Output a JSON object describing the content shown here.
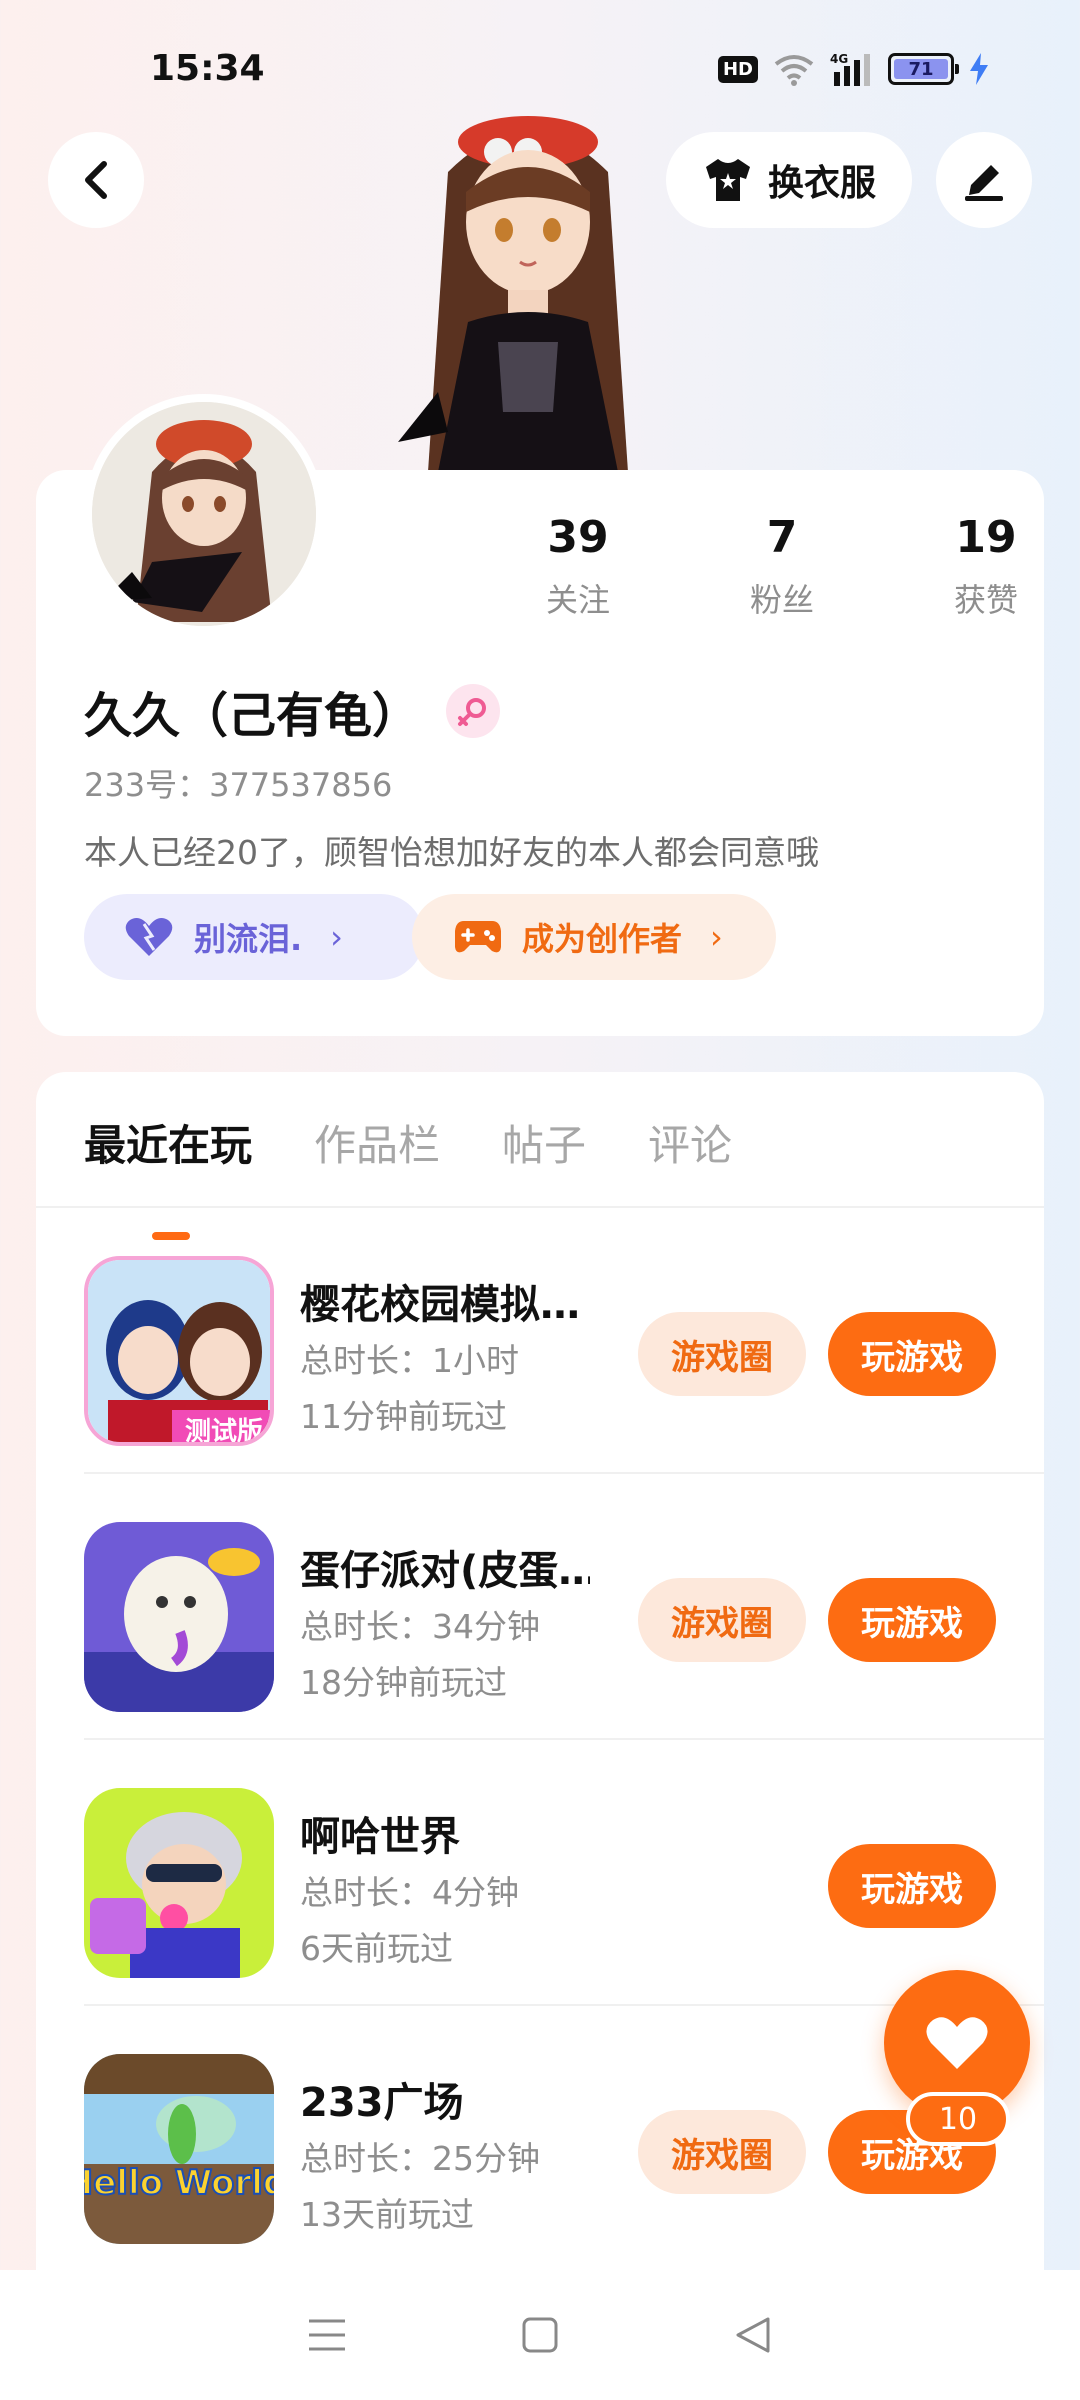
{
  "status_bar": {
    "time": "15:34",
    "hd": "HD",
    "network": "4G",
    "battery": "71"
  },
  "header": {
    "outfit_label": "换衣服"
  },
  "profile": {
    "stats": [
      {
        "value": "39",
        "label": "关注"
      },
      {
        "value": "7",
        "label": "粉丝"
      },
      {
        "value": "19",
        "label": "获赞"
      }
    ],
    "name": "久久（己有龟）",
    "id_line": "233号：377537856",
    "bio": "本人已经20了，顾智怡想加好友的本人都会同意哦",
    "group_pill": "别流泪.",
    "creator_pill": "成为创作者"
  },
  "tabs": [
    "最近在玩",
    "作品栏",
    "帖子",
    "评论"
  ],
  "games": [
    {
      "title": "樱花校园模拟…",
      "duration": "总时长：1小时",
      "last_played": "11分钟前玩过",
      "circle_label": "游戏圈",
      "play_label": "玩游戏",
      "icon_text": "测试版"
    },
    {
      "title": "蛋仔派对(皮蛋…",
      "duration": "总时长：34分钟",
      "last_played": "18分钟前玩过",
      "circle_label": "游戏圈",
      "play_label": "玩游戏"
    },
    {
      "title": "啊哈世界",
      "duration": "总时长：4分钟",
      "last_played": "6天前玩过",
      "play_label": "玩游戏"
    },
    {
      "title": "233广场",
      "duration": "总时长：25分钟",
      "last_played": "13天前玩过",
      "circle_label": "游戏圈",
      "play_label": "玩游戏",
      "icon_text": "Hello World"
    }
  ],
  "like_fab": {
    "count": "10"
  },
  "colors": {
    "accent": "#fd6c12",
    "pill_purple": "#6a63d8"
  }
}
